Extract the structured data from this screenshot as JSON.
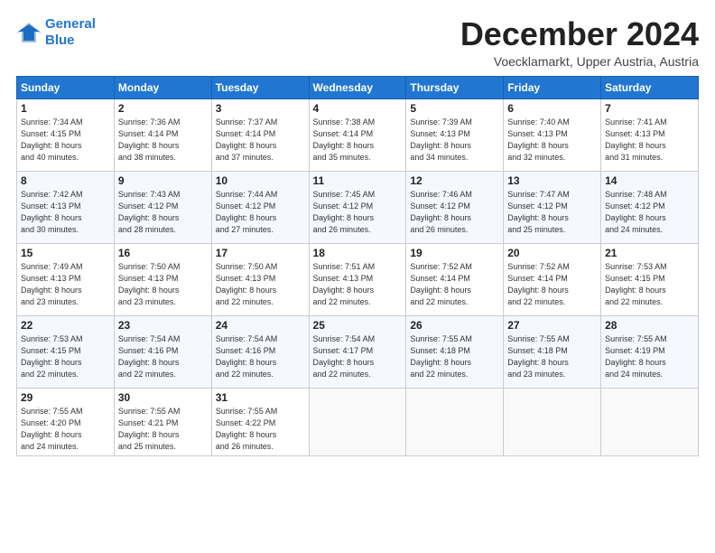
{
  "logo": {
    "line1": "General",
    "line2": "Blue"
  },
  "title": "December 2024",
  "subtitle": "Voecklamarkt, Upper Austria, Austria",
  "weekdays": [
    "Sunday",
    "Monday",
    "Tuesday",
    "Wednesday",
    "Thursday",
    "Friday",
    "Saturday"
  ],
  "weeks": [
    [
      {
        "day": "1",
        "info": "Sunrise: 7:34 AM\nSunset: 4:15 PM\nDaylight: 8 hours\nand 40 minutes."
      },
      {
        "day": "2",
        "info": "Sunrise: 7:36 AM\nSunset: 4:14 PM\nDaylight: 8 hours\nand 38 minutes."
      },
      {
        "day": "3",
        "info": "Sunrise: 7:37 AM\nSunset: 4:14 PM\nDaylight: 8 hours\nand 37 minutes."
      },
      {
        "day": "4",
        "info": "Sunrise: 7:38 AM\nSunset: 4:14 PM\nDaylight: 8 hours\nand 35 minutes."
      },
      {
        "day": "5",
        "info": "Sunrise: 7:39 AM\nSunset: 4:13 PM\nDaylight: 8 hours\nand 34 minutes."
      },
      {
        "day": "6",
        "info": "Sunrise: 7:40 AM\nSunset: 4:13 PM\nDaylight: 8 hours\nand 32 minutes."
      },
      {
        "day": "7",
        "info": "Sunrise: 7:41 AM\nSunset: 4:13 PM\nDaylight: 8 hours\nand 31 minutes."
      }
    ],
    [
      {
        "day": "8",
        "info": "Sunrise: 7:42 AM\nSunset: 4:13 PM\nDaylight: 8 hours\nand 30 minutes."
      },
      {
        "day": "9",
        "info": "Sunrise: 7:43 AM\nSunset: 4:12 PM\nDaylight: 8 hours\nand 28 minutes."
      },
      {
        "day": "10",
        "info": "Sunrise: 7:44 AM\nSunset: 4:12 PM\nDaylight: 8 hours\nand 27 minutes."
      },
      {
        "day": "11",
        "info": "Sunrise: 7:45 AM\nSunset: 4:12 PM\nDaylight: 8 hours\nand 26 minutes."
      },
      {
        "day": "12",
        "info": "Sunrise: 7:46 AM\nSunset: 4:12 PM\nDaylight: 8 hours\nand 26 minutes."
      },
      {
        "day": "13",
        "info": "Sunrise: 7:47 AM\nSunset: 4:12 PM\nDaylight: 8 hours\nand 25 minutes."
      },
      {
        "day": "14",
        "info": "Sunrise: 7:48 AM\nSunset: 4:12 PM\nDaylight: 8 hours\nand 24 minutes."
      }
    ],
    [
      {
        "day": "15",
        "info": "Sunrise: 7:49 AM\nSunset: 4:13 PM\nDaylight: 8 hours\nand 23 minutes."
      },
      {
        "day": "16",
        "info": "Sunrise: 7:50 AM\nSunset: 4:13 PM\nDaylight: 8 hours\nand 23 minutes."
      },
      {
        "day": "17",
        "info": "Sunrise: 7:50 AM\nSunset: 4:13 PM\nDaylight: 8 hours\nand 22 minutes."
      },
      {
        "day": "18",
        "info": "Sunrise: 7:51 AM\nSunset: 4:13 PM\nDaylight: 8 hours\nand 22 minutes."
      },
      {
        "day": "19",
        "info": "Sunrise: 7:52 AM\nSunset: 4:14 PM\nDaylight: 8 hours\nand 22 minutes."
      },
      {
        "day": "20",
        "info": "Sunrise: 7:52 AM\nSunset: 4:14 PM\nDaylight: 8 hours\nand 22 minutes."
      },
      {
        "day": "21",
        "info": "Sunrise: 7:53 AM\nSunset: 4:15 PM\nDaylight: 8 hours\nand 22 minutes."
      }
    ],
    [
      {
        "day": "22",
        "info": "Sunrise: 7:53 AM\nSunset: 4:15 PM\nDaylight: 8 hours\nand 22 minutes."
      },
      {
        "day": "23",
        "info": "Sunrise: 7:54 AM\nSunset: 4:16 PM\nDaylight: 8 hours\nand 22 minutes."
      },
      {
        "day": "24",
        "info": "Sunrise: 7:54 AM\nSunset: 4:16 PM\nDaylight: 8 hours\nand 22 minutes."
      },
      {
        "day": "25",
        "info": "Sunrise: 7:54 AM\nSunset: 4:17 PM\nDaylight: 8 hours\nand 22 minutes."
      },
      {
        "day": "26",
        "info": "Sunrise: 7:55 AM\nSunset: 4:18 PM\nDaylight: 8 hours\nand 22 minutes."
      },
      {
        "day": "27",
        "info": "Sunrise: 7:55 AM\nSunset: 4:18 PM\nDaylight: 8 hours\nand 23 minutes."
      },
      {
        "day": "28",
        "info": "Sunrise: 7:55 AM\nSunset: 4:19 PM\nDaylight: 8 hours\nand 24 minutes."
      }
    ],
    [
      {
        "day": "29",
        "info": "Sunrise: 7:55 AM\nSunset: 4:20 PM\nDaylight: 8 hours\nand 24 minutes."
      },
      {
        "day": "30",
        "info": "Sunrise: 7:55 AM\nSunset: 4:21 PM\nDaylight: 8 hours\nand 25 minutes."
      },
      {
        "day": "31",
        "info": "Sunrise: 7:55 AM\nSunset: 4:22 PM\nDaylight: 8 hours\nand 26 minutes."
      },
      {
        "day": "",
        "info": ""
      },
      {
        "day": "",
        "info": ""
      },
      {
        "day": "",
        "info": ""
      },
      {
        "day": "",
        "info": ""
      }
    ]
  ]
}
